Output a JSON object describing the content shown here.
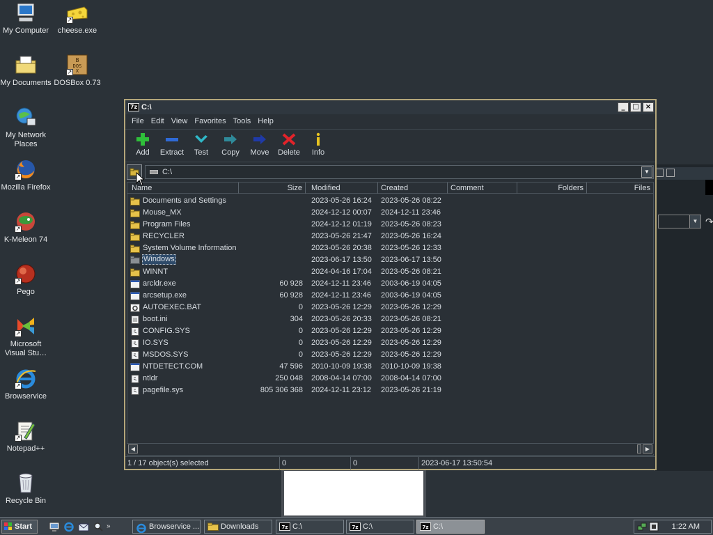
{
  "desktop": {
    "icons": [
      {
        "label": "My Computer",
        "icon": "computer-icon"
      },
      {
        "label": "cheese.exe",
        "icon": "cheese-icon"
      },
      {
        "label": "My Documents",
        "icon": "documents-folder-icon"
      },
      {
        "label": "DOSBox 0.73",
        "icon": "dosbox-icon"
      },
      {
        "label": "My Network Places",
        "icon": "network-icon"
      },
      {
        "label": "Mozilla Firefox",
        "icon": "firefox-icon"
      },
      {
        "label": "K-Meleon 74",
        "icon": "kmeleon-icon"
      },
      {
        "label": "Pego",
        "icon": "pego-icon"
      },
      {
        "label": "Microsoft Visual Stu…",
        "icon": "visual-studio-icon"
      },
      {
        "label": "Browservice",
        "icon": "internet-explorer-icon"
      },
      {
        "label": "Notepad++",
        "icon": "notepadpp-icon"
      },
      {
        "label": "Recycle Bin",
        "icon": "recycle-bin-icon"
      }
    ]
  },
  "window": {
    "title": "C:\\",
    "app_icon_text": "7z",
    "controls": {
      "minimize": "_",
      "maximize": "□",
      "close": "×"
    },
    "menu": [
      "File",
      "Edit",
      "View",
      "Favorites",
      "Tools",
      "Help"
    ],
    "toolbar": [
      {
        "label": "Add",
        "icon": "add-icon"
      },
      {
        "label": "Extract",
        "icon": "extract-icon"
      },
      {
        "label": "Test",
        "icon": "test-icon"
      },
      {
        "label": "Copy",
        "icon": "copy-icon"
      },
      {
        "label": "Move",
        "icon": "move-icon"
      },
      {
        "label": "Delete",
        "icon": "delete-icon"
      },
      {
        "label": "Info",
        "icon": "info-icon"
      }
    ],
    "address": "C:\\",
    "columns": [
      "Name",
      "Size",
      "Modified",
      "Created",
      "Comment",
      "Folders",
      "Files"
    ],
    "rows": [
      {
        "name": "Documents and Settings",
        "size": "",
        "modified": "2023-05-26 16:24",
        "created": "2023-05-26 08:22",
        "type": "folder"
      },
      {
        "name": "Mouse_MX",
        "size": "",
        "modified": "2024-12-12 00:07",
        "created": "2024-12-11 23:46",
        "type": "folder"
      },
      {
        "name": "Program Files",
        "size": "",
        "modified": "2024-12-12 01:19",
        "created": "2023-05-26 08:23",
        "type": "folder"
      },
      {
        "name": "RECYCLER",
        "size": "",
        "modified": "2023-05-26 21:47",
        "created": "2023-05-26 16:24",
        "type": "folder"
      },
      {
        "name": "System Volume Information",
        "size": "",
        "modified": "2023-05-26 20:38",
        "created": "2023-05-26 12:33",
        "type": "folder"
      },
      {
        "name": "Windows",
        "size": "",
        "modified": "2023-06-17 13:50",
        "created": "2023-06-17 13:50",
        "type": "folder-gray",
        "focused": true
      },
      {
        "name": "WINNT",
        "size": "",
        "modified": "2024-04-16 17:04",
        "created": "2023-05-26 08:21",
        "type": "folder"
      },
      {
        "name": "arcldr.exe",
        "size": "60 928",
        "modified": "2024-12-11 23:46",
        "created": "2003-06-19 04:05",
        "type": "exe"
      },
      {
        "name": "arcsetup.exe",
        "size": "60 928",
        "modified": "2024-12-11 23:46",
        "created": "2003-06-19 04:05",
        "type": "exe"
      },
      {
        "name": "AUTOEXEC.BAT",
        "size": "0",
        "modified": "2023-05-26 12:29",
        "created": "2023-05-26 12:29",
        "type": "bat"
      },
      {
        "name": "boot.ini",
        "size": "304",
        "modified": "2023-05-26 20:33",
        "created": "2023-05-26 08:21",
        "type": "ini"
      },
      {
        "name": "CONFIG.SYS",
        "size": "0",
        "modified": "2023-05-26 12:29",
        "created": "2023-05-26 12:29",
        "type": "sys"
      },
      {
        "name": "IO.SYS",
        "size": "0",
        "modified": "2023-05-26 12:29",
        "created": "2023-05-26 12:29",
        "type": "sys"
      },
      {
        "name": "MSDOS.SYS",
        "size": "0",
        "modified": "2023-05-26 12:29",
        "created": "2023-05-26 12:29",
        "type": "sys"
      },
      {
        "name": "NTDETECT.COM",
        "size": "47 596",
        "modified": "2010-10-09 19:38",
        "created": "2010-10-09 19:38",
        "type": "exe"
      },
      {
        "name": "ntldr",
        "size": "250 048",
        "modified": "2008-04-14 07:00",
        "created": "2008-04-14 07:00",
        "type": "sys"
      },
      {
        "name": "pagefile.sys",
        "size": "805 306 368",
        "modified": "2024-12-11 23:12",
        "created": "2023-05-26 21:19",
        "type": "sys"
      }
    ],
    "status": {
      "selection": "1 / 17 object(s) selected",
      "size1": "0",
      "size2": "0",
      "date": "2023-06-17 13:50:54"
    }
  },
  "taskbar": {
    "start_label": "Start",
    "quick_launch": [
      "show-desktop-icon",
      "internet-explorer-icon",
      "outlook-icon",
      "search-icon"
    ],
    "more": "»",
    "tasks": [
      {
        "label": "Browservice ...",
        "icon": "internet-explorer-icon",
        "active": false
      },
      {
        "label": "Downloads",
        "icon": "folder-icon",
        "active": false
      },
      {
        "label": "C:\\",
        "icon": "sevenzip-icon",
        "active": false
      },
      {
        "label": "C:\\",
        "icon": "sevenzip-icon",
        "active": false
      },
      {
        "label": "C:\\",
        "icon": "sevenzip-icon",
        "active": true
      }
    ],
    "clock": "1:22 AM"
  }
}
